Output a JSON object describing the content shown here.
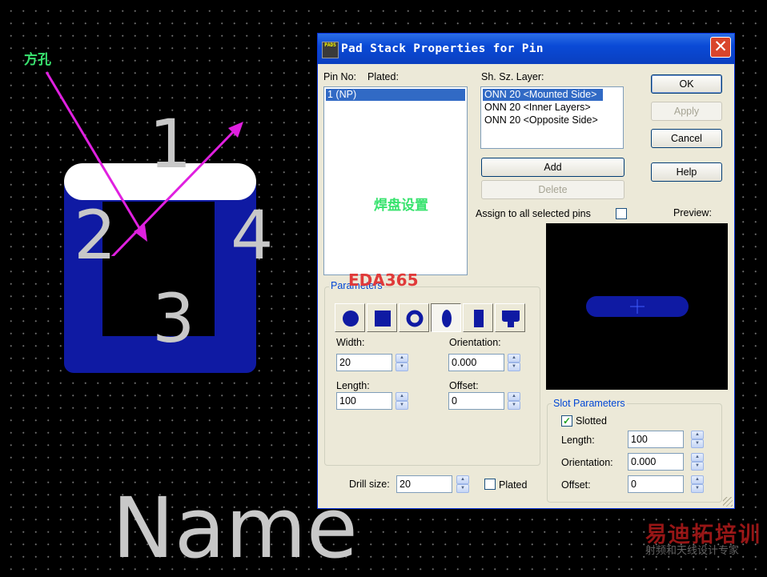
{
  "canvas": {
    "annotation_square_hole": "方孔",
    "pin_labels": [
      "1",
      "2",
      "3",
      "4"
    ],
    "component_name": "Name",
    "arrow_color": "#e020e0"
  },
  "dialog": {
    "title": "Pad Stack Properties for Pin",
    "close_symbol": "✕",
    "pin_no_label": "Pin No:",
    "plated_label": "Plated:",
    "pin_list": [
      {
        "text": "1 (NP)",
        "selected": true
      }
    ],
    "layer_list_label": "Sh. Sz. Layer:",
    "layer_list": [
      {
        "text": "ONN 20 <Mounted Side>",
        "selected": true
      },
      {
        "text": "ONN 20 <Inner Layers>",
        "selected": false
      },
      {
        "text": "ONN 20 <Opposite Side>",
        "selected": false
      }
    ],
    "buttons": {
      "ok": "OK",
      "apply": "Apply",
      "cancel": "Cancel",
      "help": "Help",
      "add": "Add",
      "delete": "Delete"
    },
    "assign_all_label": "Assign to all selected pins",
    "assign_all_checked": false,
    "preview_label": "Preview:",
    "parameters": {
      "title": "Parameters",
      "shapes": [
        {
          "name": "round",
          "active": false
        },
        {
          "name": "square",
          "active": false
        },
        {
          "name": "annular",
          "active": false
        },
        {
          "name": "oval",
          "active": true
        },
        {
          "name": "rectangle",
          "active": false
        },
        {
          "name": "odd",
          "active": false
        }
      ],
      "width_label": "Width:",
      "width_value": "20",
      "orientation_label": "Orientation:",
      "orientation_value": "0.000",
      "length_label": "Length:",
      "length_value": "100",
      "offset_label": "Offset:",
      "offset_value": "0"
    },
    "drill": {
      "label": "Drill size:",
      "value": "20",
      "plated_label": "Plated",
      "plated_checked": false
    },
    "slot": {
      "title": "Slot Parameters",
      "slotted_label": "Slotted",
      "slotted_checked": true,
      "length_label": "Length:",
      "length_value": "100",
      "orientation_label": "Orientation:",
      "orientation_value": "0.000",
      "offset_label": "Offset:",
      "offset_value": "0"
    },
    "overlay_pad_settings": "焊盘设置",
    "overlay_brand": "EDA365",
    "title_icon_text": "PADS"
  },
  "watermark": {
    "line1": "易迪拓培训",
    "line2": "射频和天线设计专家"
  },
  "colors": {
    "pad_blue": "#0f1aa3",
    "selection_blue": "#316ac5",
    "group_title_blue": "#0046d5",
    "annotation_green": "#39e36f"
  }
}
